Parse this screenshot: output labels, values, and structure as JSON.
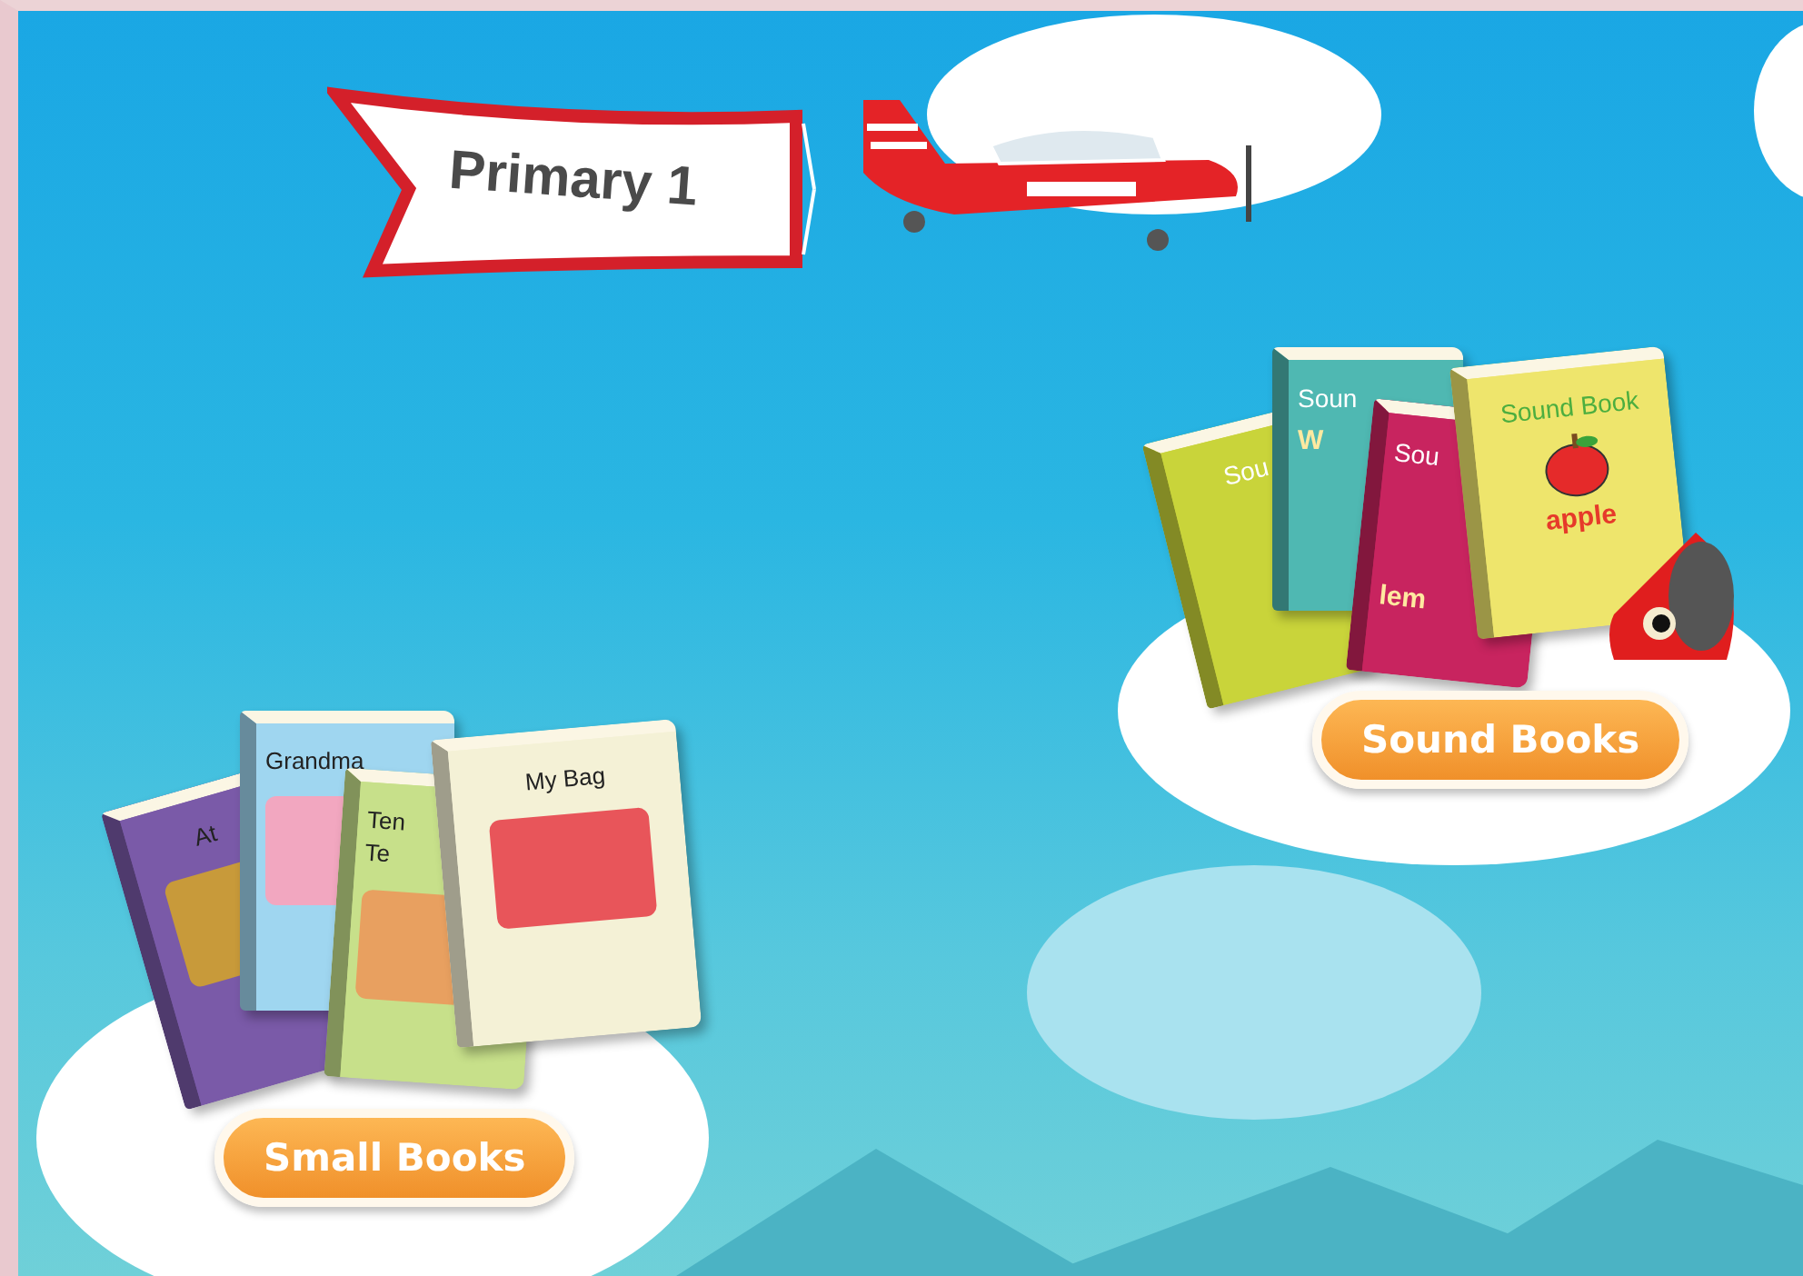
{
  "banner": {
    "text": "Primary 1"
  },
  "shelves": [
    {
      "kind": "sound",
      "button": "Sound Books",
      "books": [
        {
          "lines": [
            "Sou"
          ],
          "color": "#c9d43a"
        },
        {
          "lines": [
            "Soun"
          ],
          "word": "W",
          "color": "#4fb8b2"
        },
        {
          "lines": [
            "Sou"
          ],
          "word": "lem",
          "color": "#c8245f"
        },
        {
          "lines": [
            "Sound Book"
          ],
          "word": "apple",
          "color": "#eee56c"
        }
      ]
    },
    {
      "kind": "small",
      "button": "Small Books",
      "books": [
        {
          "lines": [
            "At"
          ],
          "color": "#7a5aa8"
        },
        {
          "lines": [
            "Grandma"
          ],
          "color": "#9fd6f0"
        },
        {
          "lines": [
            "Ten",
            "Te"
          ],
          "color": "#c7e08a"
        },
        {
          "lines": [
            "My Bag"
          ],
          "color": "#f4f1d6"
        }
      ]
    }
  ]
}
